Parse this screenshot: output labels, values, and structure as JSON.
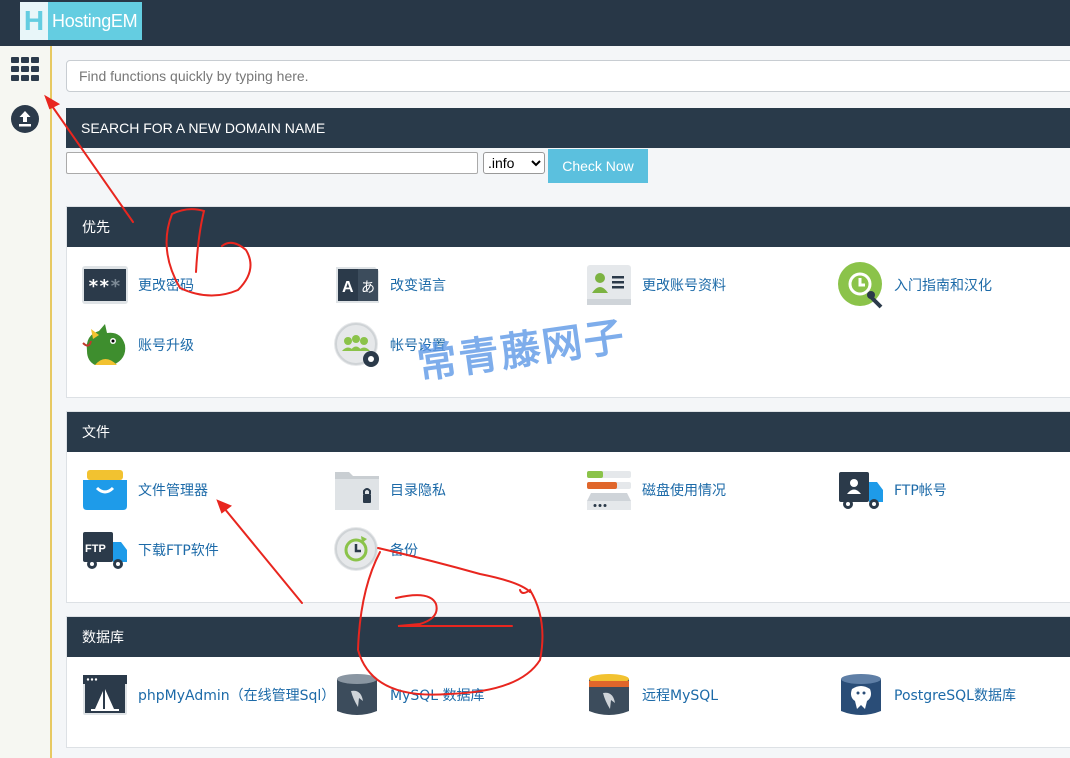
{
  "header": {
    "logo_letter": "H",
    "logo_text": "HostingEM"
  },
  "sidebar": {
    "items": [
      {
        "name": "apps-grid-icon"
      },
      {
        "name": "upload-icon"
      }
    ]
  },
  "search": {
    "placeholder": "Find functions quickly by typing here."
  },
  "domain_search": {
    "title": "SEARCH FOR A NEW DOMAIN NAME",
    "input_value": "",
    "tld_selected": ".info",
    "button_label": "Check Now"
  },
  "sections": {
    "priority": {
      "title": "优先",
      "items": [
        {
          "label": "更改密码",
          "icon": "password-icon"
        },
        {
          "label": "改变语言",
          "icon": "language-icon"
        },
        {
          "label": "更改账号资料",
          "icon": "contact-info-icon"
        },
        {
          "label": "入门指南和汉化",
          "icon": "getting-started-icon"
        },
        {
          "label": "账号升级",
          "icon": "upgrade-dragon-icon"
        },
        {
          "label": "帐号设置",
          "icon": "account-settings-icon"
        }
      ]
    },
    "files": {
      "title": "文件",
      "items": [
        {
          "label": "文件管理器",
          "icon": "file-manager-icon"
        },
        {
          "label": "目录隐私",
          "icon": "directory-privacy-icon"
        },
        {
          "label": "磁盘使用情况",
          "icon": "disk-usage-icon"
        },
        {
          "label": "FTP帐号",
          "icon": "ftp-accounts-icon"
        },
        {
          "label": "下载FTP软件",
          "icon": "ftp-download-icon"
        },
        {
          "label": "备份",
          "icon": "backup-icon"
        }
      ]
    },
    "databases": {
      "title": "数据库",
      "items": [
        {
          "label": "phpMyAdmin（在线管理Sql）",
          "icon": "phpmyadmin-icon"
        },
        {
          "label": "MySQL 数据库",
          "icon": "mysql-database-icon"
        },
        {
          "label": "远程MySQL",
          "icon": "remote-mysql-icon"
        },
        {
          "label": "PostgreSQL数据库",
          "icon": "postgresql-icon"
        }
      ]
    }
  },
  "watermark": "常青藤网子",
  "colors": {
    "header": "#283747",
    "panel_head": "#293a4a",
    "logo": "#64cde1",
    "link": "#1c6aa8",
    "button": "#5bc0de",
    "annotation": "#e8261f"
  }
}
